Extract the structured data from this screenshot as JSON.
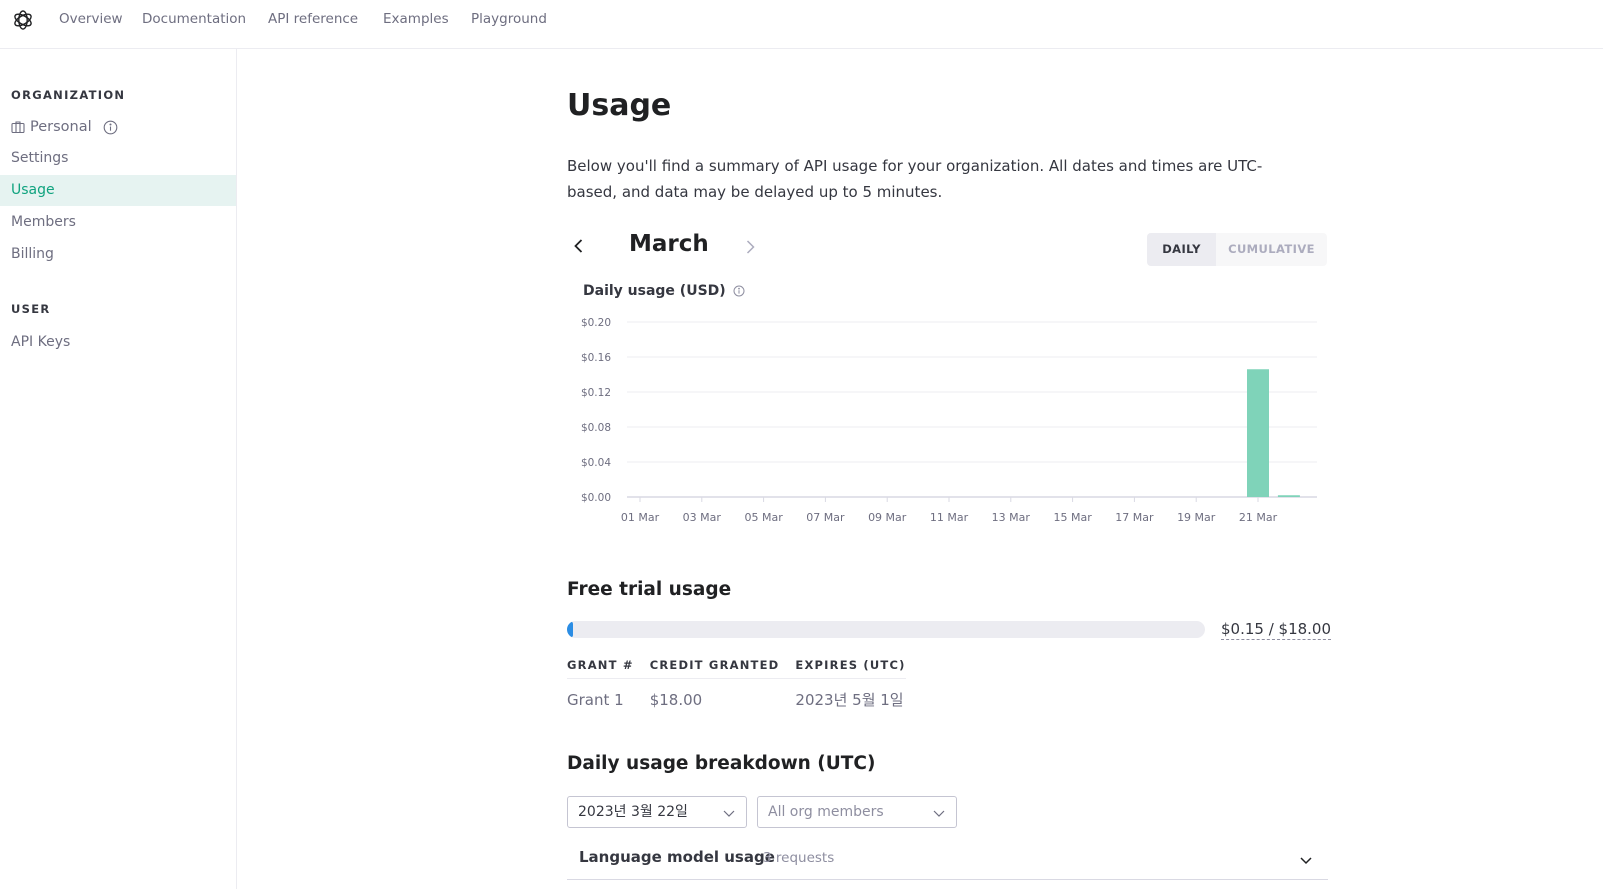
{
  "nav": {
    "logo": "openai-logo-icon",
    "links": [
      "Overview",
      "Documentation",
      "API reference",
      "Examples",
      "Playground"
    ]
  },
  "sidebar": {
    "org_heading": "ORGANIZATION",
    "org_name": "Personal",
    "org_items": [
      "Settings",
      "Usage",
      "Members",
      "Billing"
    ],
    "active_item": "Usage",
    "user_heading": "USER",
    "user_items": [
      "API Keys"
    ]
  },
  "page": {
    "title": "Usage",
    "description": "Below you'll find a summary of API usage for your organization. All dates and times are UTC-based, and data may be delayed up to 5 minutes."
  },
  "month_nav": {
    "label": "March",
    "prev_icon": "chevron-left-icon",
    "next_icon": "chevron-right-icon"
  },
  "view_toggle": {
    "options": [
      "DAILY",
      "CUMULATIVE"
    ],
    "selected": "DAILY"
  },
  "chart_data": {
    "type": "bar",
    "title": "Daily usage (USD)",
    "xlabel": "",
    "ylabel": "",
    "ylim": [
      0,
      0.2
    ],
    "yticks": [
      "$0.00",
      "$0.04",
      "$0.08",
      "$0.12",
      "$0.16",
      "$0.20"
    ],
    "ytick_values": [
      0,
      0.04,
      0.08,
      0.12,
      0.16,
      0.2
    ],
    "categories": [
      "01 Mar",
      "02 Mar",
      "03 Mar",
      "04 Mar",
      "05 Mar",
      "06 Mar",
      "07 Mar",
      "08 Mar",
      "09 Mar",
      "10 Mar",
      "11 Mar",
      "12 Mar",
      "13 Mar",
      "14 Mar",
      "15 Mar",
      "16 Mar",
      "17 Mar",
      "18 Mar",
      "19 Mar",
      "20 Mar",
      "21 Mar",
      "22 Mar"
    ],
    "xtick_labels": [
      "01 Mar",
      "03 Mar",
      "05 Mar",
      "07 Mar",
      "09 Mar",
      "11 Mar",
      "13 Mar",
      "15 Mar",
      "17 Mar",
      "19 Mar",
      "21 Mar"
    ],
    "values": [
      0,
      0,
      0,
      0,
      0,
      0,
      0,
      0,
      0,
      0,
      0,
      0,
      0,
      0,
      0,
      0,
      0,
      0,
      0,
      0,
      0.146,
      0.002
    ],
    "bar_color": "#7fd3b9",
    "grid": true,
    "legend": "none"
  },
  "free_trial": {
    "title": "Free trial usage",
    "used": 0.15,
    "total": 18.0,
    "progress_fraction": 0.0083,
    "progress_text": "$0.15 / $18.00",
    "table": {
      "headers": [
        "GRANT #",
        "CREDIT GRANTED",
        "EXPIRES (UTC)"
      ],
      "rows": [
        [
          "Grant 1",
          "$18.00",
          "2023년 5월 1일"
        ]
      ]
    }
  },
  "breakdown": {
    "title": "Daily usage breakdown (UTC)",
    "date_select": "2023년 3월 22일",
    "member_select": "All org members",
    "accordion_title": "Language model usage",
    "accordion_count": "3 requests"
  },
  "colors": {
    "accent": "#10a37f",
    "active_bg": "#e6f3f1",
    "progress": "#2b8de4"
  }
}
